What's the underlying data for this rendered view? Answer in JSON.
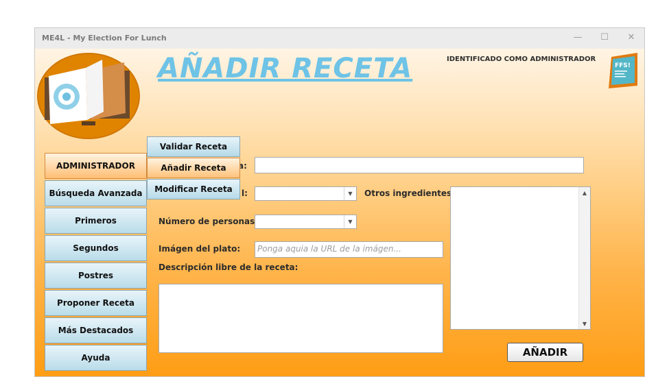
{
  "window": {
    "title": "ME4L - My Election For Lunch",
    "minimize_glyph": "—",
    "maximize_glyph": "☐",
    "close_glyph": "✕"
  },
  "header": {
    "page_title": "AÑADIR RECETA",
    "identified_as": "IDENTIFICADO COMO ADMINISTRADOR",
    "badge_text": "FFS!"
  },
  "sidebar": {
    "items": [
      {
        "label": "ADMINISTRADOR",
        "active": true
      },
      {
        "label": "Búsqueda Avanzada"
      },
      {
        "label": "Primeros"
      },
      {
        "label": "Segundos"
      },
      {
        "label": "Postres"
      },
      {
        "label": "Proponer Receta"
      },
      {
        "label": "Más Destacados"
      },
      {
        "label": "Ayuda"
      }
    ]
  },
  "submenu": {
    "items": [
      {
        "label": "Validar Receta"
      },
      {
        "label": "Añadir Receta",
        "selected": true
      },
      {
        "label": "Modificar Receta"
      }
    ]
  },
  "form": {
    "name_label_fragment": "a:",
    "name_value": "",
    "main_ingredient_label_fragment": "l:",
    "main_ingredient_value": "",
    "other_ingredients_label": "Otros ingredientes:",
    "persons_label": "Número de personas:",
    "persons_value": "",
    "image_label": "Imágen del plato:",
    "image_placeholder": "Ponga aquia la URL de la imágen...",
    "description_label": "Descripción libre de la receta:",
    "description_value": "",
    "submit_label": "AÑADIR"
  },
  "colors": {
    "title_blue": "#6ec3e6",
    "gradient_top": "#fff4e4",
    "gradient_bottom": "#ff9d14",
    "button_blue": "#b9dce9",
    "button_active_orange": "#ffbe74"
  },
  "icons": [
    "recipe-book-logo",
    "ffsi-badge-icon",
    "combo-arrow-icon",
    "scroll-up-icon",
    "scroll-down-icon"
  ]
}
